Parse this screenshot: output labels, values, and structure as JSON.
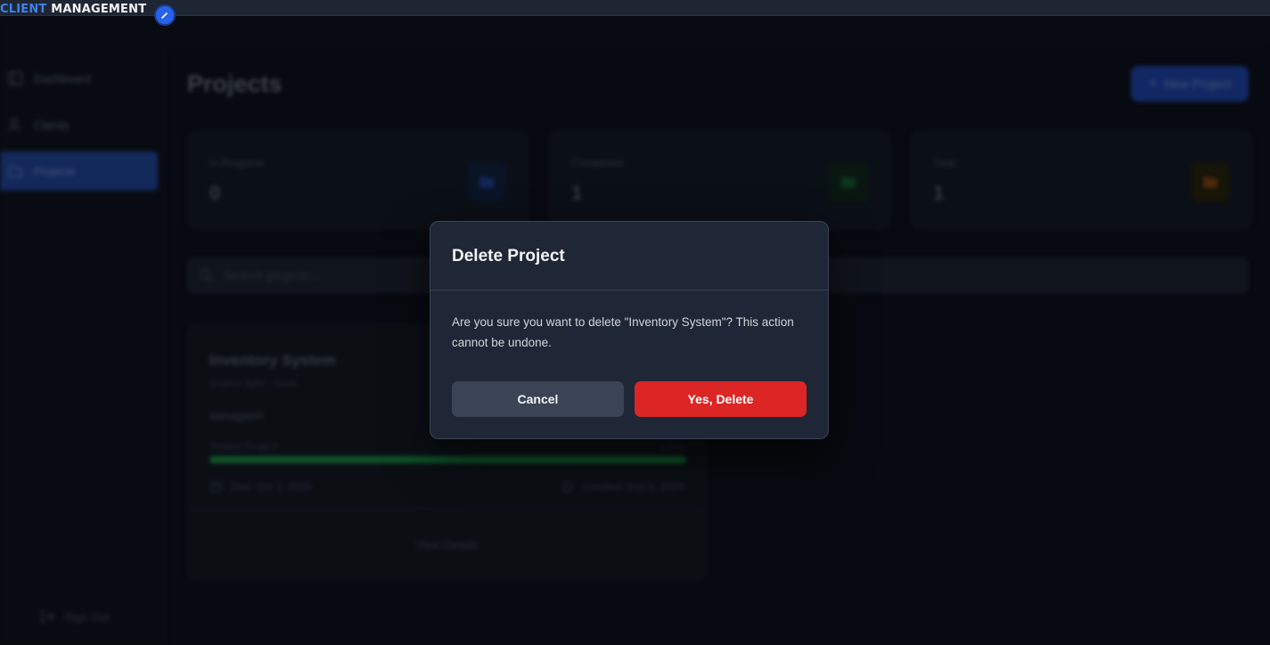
{
  "brand": {
    "part1": "CLIENT",
    "part2": "MANAGEMENT"
  },
  "sidebar": {
    "items": [
      {
        "label": "Dashboard",
        "icon": "layout-icon",
        "active": false
      },
      {
        "label": "Clients",
        "icon": "users-icon",
        "active": false
      },
      {
        "label": "Projects",
        "icon": "folder-icon",
        "active": true
      }
    ],
    "signout_label": "Sign Out"
  },
  "main": {
    "title": "Projects",
    "new_button_label": "New Project",
    "stats": [
      {
        "label": "In Progress",
        "value": "0",
        "color": "#3b82f6"
      },
      {
        "label": "Completed",
        "value": "1",
        "color": "#22c55e"
      },
      {
        "label": "Total",
        "value": "1",
        "color": "#eab308"
      }
    ],
    "search_placeholder": "Search projects...",
    "project": {
      "name": "Inventory System",
      "subtitle": "project light - mine",
      "client": "asmaganh",
      "status_label": "Tested Project",
      "progress_text": "100%",
      "progress": 1.0,
      "due": "Due: Oct 1, 2025",
      "created": "Created: Sep 6, 2025",
      "view_details_label": "View Details"
    }
  },
  "modal": {
    "title": "Delete Project",
    "message": "Are you sure you want to delete \"Inventory System\"? This action cannot be undone.",
    "cancel_label": "Cancel",
    "confirm_label": "Yes, Delete"
  },
  "colors": {
    "accent": "#2563eb",
    "danger": "#dc2626",
    "modal_bg": "#1f2736"
  }
}
